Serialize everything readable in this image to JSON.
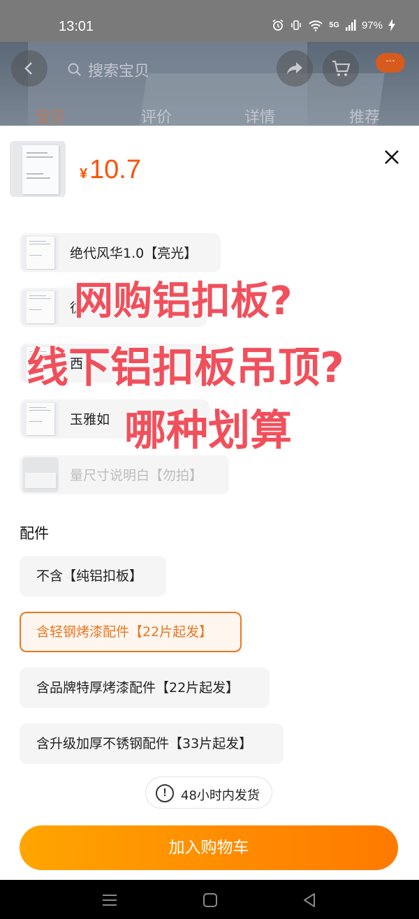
{
  "status_bar": {
    "time": "13:01",
    "network": "5G",
    "battery": "97%"
  },
  "background_page": {
    "search_placeholder": "搜索宝贝",
    "menu_badge": "···",
    "tabs": [
      {
        "label": "宝贝",
        "active": true
      },
      {
        "label": "评价",
        "active": false
      },
      {
        "label": "详情",
        "active": false
      },
      {
        "label": "推荐",
        "active": false
      }
    ]
  },
  "product": {
    "price_symbol": "¥",
    "price": "10.7",
    "thumbnail_text": "",
    "close_icon": "close-icon"
  },
  "specs": [
    {
      "label": "绝代风华1.0【亮光】",
      "enabled": true
    },
    {
      "label": "彷",
      "enabled": true
    },
    {
      "label": "西",
      "enabled": true
    },
    {
      "label": "玉雅如",
      "enabled": true
    },
    {
      "label": "量尺寸说明白【勿拍】",
      "enabled": false
    }
  ],
  "overlay": {
    "line1": "网购铝扣板?",
    "line2": "线下铝扣板吊顶?",
    "line3": "哪种划算",
    "color": "#f0505c"
  },
  "accessories": {
    "title": "配件",
    "options": [
      {
        "label": "不含【纯铝扣板】",
        "selected": false
      },
      {
        "label": "含轻钢烤漆配件【22片起发】",
        "selected": true
      },
      {
        "label": "含品牌特厚烤漆配件【22片起发】",
        "selected": false
      },
      {
        "label": "含升级加厚不锈钢配件【33片起发】",
        "selected": false
      }
    ]
  },
  "shipping": {
    "icon": "exclamation-icon",
    "text": "48小时内发货"
  },
  "actions": {
    "add_to_cart": "加入购物车",
    "accent": "#ff8a00"
  },
  "nav_bar": {
    "icons": [
      "menu-icon",
      "home-icon",
      "back-icon"
    ]
  }
}
